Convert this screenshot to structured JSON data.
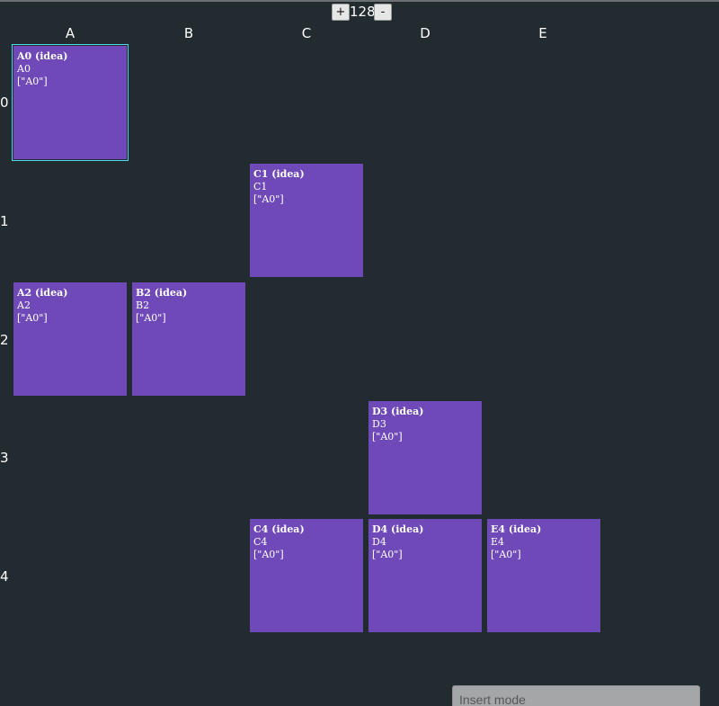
{
  "zoom": {
    "plus_label": "+",
    "value": "128",
    "minus_label": "-"
  },
  "columns": [
    "A",
    "B",
    "C",
    "D",
    "E"
  ],
  "rows": [
    "0",
    "1",
    "2",
    "3",
    "4"
  ],
  "cells": [
    {
      "id": "A0",
      "title": "A0 (idea)",
      "line1": "A0",
      "line2": "[\"A0\"]",
      "selected": true
    },
    {
      "id": "C1",
      "title": "C1 (idea)",
      "line1": "C1",
      "line2": "[\"A0\"]"
    },
    {
      "id": "A2",
      "title": "A2 (idea)",
      "line1": "A2",
      "line2": "[\"A0\"]"
    },
    {
      "id": "B2",
      "title": "B2 (idea)",
      "line1": "B2",
      "line2": "[\"A0\"]"
    },
    {
      "id": "D3",
      "title": "D3 (idea)",
      "line1": "D3",
      "line2": "[\"A0\"]"
    },
    {
      "id": "C4",
      "title": "C4 (idea)",
      "line1": "C4",
      "line2": "[\"A0\"]"
    },
    {
      "id": "D4",
      "title": "D4 (idea)",
      "line1": "D4",
      "line2": "[\"A0\"]"
    },
    {
      "id": "E4",
      "title": "E4 (idea)",
      "line1": "E4",
      "line2": "[\"A0\"]"
    }
  ],
  "status": {
    "mode_text": "Insert mode"
  },
  "colors": {
    "background": "#222b2f",
    "cell": "#7049b8",
    "selection": "#4fd8f0"
  }
}
